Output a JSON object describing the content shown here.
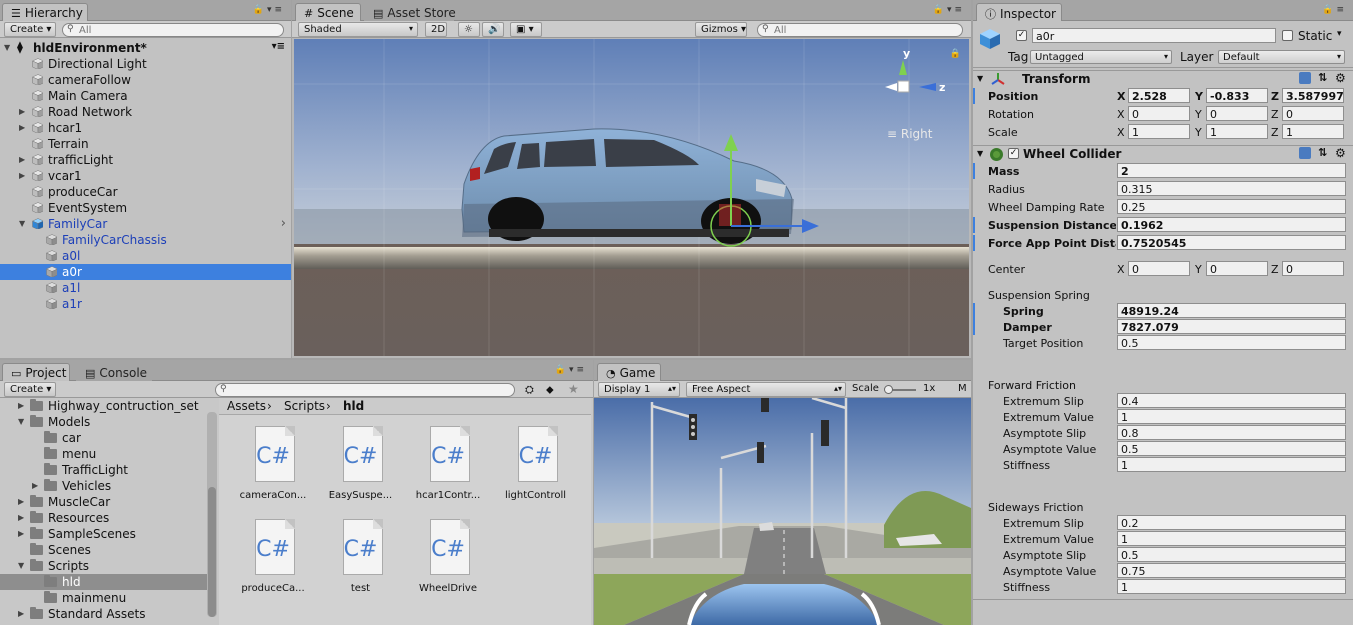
{
  "hierarchy": {
    "tab": "Hierarchy",
    "create_label": "Create",
    "search_placeholder": "All",
    "scene_name": "hldEnvironment*",
    "items": [
      {
        "label": "Directional Light",
        "expandable": false,
        "prefab": false
      },
      {
        "label": "cameraFollow",
        "expandable": false,
        "prefab": false
      },
      {
        "label": "Main Camera",
        "expandable": false,
        "prefab": false
      },
      {
        "label": "Road Network",
        "expandable": true,
        "prefab": false
      },
      {
        "label": "hcar1",
        "expandable": true,
        "prefab": false
      },
      {
        "label": "Terrain",
        "expandable": false,
        "prefab": false
      },
      {
        "label": "trafficLight",
        "expandable": true,
        "prefab": false
      },
      {
        "label": "vcar1",
        "expandable": true,
        "prefab": false
      },
      {
        "label": "produceCar",
        "expandable": false,
        "prefab": false
      },
      {
        "label": "EventSystem",
        "expandable": false,
        "prefab": false
      },
      {
        "label": "FamilyCar",
        "expandable": true,
        "expanded": true,
        "prefab": true
      },
      {
        "label": "FamilyCarChassis",
        "child": true,
        "prefab": true
      },
      {
        "label": "a0l",
        "child": true,
        "prefab": true
      },
      {
        "label": "a0r",
        "child": true,
        "prefab": true,
        "selected": true
      },
      {
        "label": "a1l",
        "child": true,
        "prefab": true
      },
      {
        "label": "a1r",
        "child": true,
        "prefab": true
      }
    ]
  },
  "scene": {
    "tabs": [
      "Scene",
      "Asset Store"
    ],
    "shading_mode": "Shaded",
    "mode_2d": "2D",
    "gizmos_label": "Gizmos",
    "search_placeholder": "All",
    "view_label": "Right",
    "axis_y": "y",
    "axis_z": "z"
  },
  "project": {
    "tabs": [
      "Project",
      "Console"
    ],
    "create_label": "Create",
    "folders": [
      {
        "label": "Highway_contruction_set",
        "level": 1,
        "expandable": true
      },
      {
        "label": "Models",
        "level": 1,
        "expandable": true,
        "expanded": true
      },
      {
        "label": "car",
        "level": 2,
        "expandable": false
      },
      {
        "label": "menu",
        "level": 2,
        "expandable": false
      },
      {
        "label": "TrafficLight",
        "level": 2,
        "expandable": false
      },
      {
        "label": "Vehicles",
        "level": 2,
        "expandable": true
      },
      {
        "label": "MuscleCar",
        "level": 1,
        "expandable": true
      },
      {
        "label": "Resources",
        "level": 1,
        "expandable": true
      },
      {
        "label": "SampleScenes",
        "level": 1,
        "expandable": true
      },
      {
        "label": "Scenes",
        "level": 1,
        "expandable": false
      },
      {
        "label": "Scripts",
        "level": 1,
        "expandable": true,
        "expanded": true
      },
      {
        "label": "hld",
        "level": 2,
        "expandable": false,
        "selected": true
      },
      {
        "label": "mainmenu",
        "level": 2,
        "expandable": false
      },
      {
        "label": "Standard Assets",
        "level": 1,
        "expandable": true
      }
    ],
    "breadcrumb": [
      "Assets",
      "Scripts",
      "hld"
    ],
    "assets": [
      {
        "icon": "C#",
        "name": "cameraCon..."
      },
      {
        "icon": "C#",
        "name": "EasySuspe..."
      },
      {
        "icon": "C#",
        "name": "hcar1Contr..."
      },
      {
        "icon": "C#",
        "name": "lightControll"
      },
      {
        "icon": "C#",
        "name": "produceCa..."
      },
      {
        "icon": "C#",
        "name": "test"
      },
      {
        "icon": "C#",
        "name": "WheelDrive"
      }
    ]
  },
  "game": {
    "tab": "Game",
    "display": "Display 1",
    "aspect": "Free Aspect",
    "scale_label": "Scale",
    "scale_value": "1x",
    "maximize_label": "M"
  },
  "inspector": {
    "tab": "Inspector",
    "object_name": "a0r",
    "static_label": "Static",
    "tag_label": "Tag",
    "tag_value": "Untagged",
    "layer_label": "Layer",
    "layer_value": "Default",
    "transform": {
      "title": "Transform",
      "position_label": "Position",
      "rotation_label": "Rotation",
      "scale_label": "Scale",
      "position": {
        "x": "2.528",
        "y": "-0.833",
        "z": "3.587997"
      },
      "rotation": {
        "x": "0",
        "y": "0",
        "z": "0"
      },
      "scale": {
        "x": "1",
        "y": "1",
        "z": "1"
      }
    },
    "axes": {
      "x": "X",
      "y": "Y",
      "z": "Z"
    },
    "wheel_collider": {
      "title": "Wheel Collider",
      "fields": [
        {
          "label": "Mass",
          "value": "2",
          "bold": true
        },
        {
          "label": "Radius",
          "value": "0.315",
          "bold": false
        },
        {
          "label": "Wheel Damping Rate",
          "value": "0.25",
          "bold": false
        },
        {
          "label": "Suspension Distance",
          "value": "0.1962",
          "bold": true
        },
        {
          "label": "Force App Point Distance",
          "value": "0.7520545",
          "bold": true
        }
      ],
      "center_label": "Center",
      "center": {
        "x": "0",
        "y": "0",
        "z": "0"
      },
      "suspension_spring": {
        "title": "Suspension Spring",
        "fields": [
          {
            "label": "Spring",
            "value": "48919.24",
            "bold": true
          },
          {
            "label": "Damper",
            "value": "7827.079",
            "bold": true
          },
          {
            "label": "Target Position",
            "value": "0.5",
            "bold": false
          }
        ]
      },
      "forward_friction": {
        "title": "Forward Friction",
        "fields": [
          {
            "label": "Extremum Slip",
            "value": "0.4"
          },
          {
            "label": "Extremum Value",
            "value": "1"
          },
          {
            "label": "Asymptote Slip",
            "value": "0.8"
          },
          {
            "label": "Asymptote Value",
            "value": "0.5"
          },
          {
            "label": "Stiffness",
            "value": "1"
          }
        ]
      },
      "sideways_friction": {
        "title": "Sideways Friction",
        "fields": [
          {
            "label": "Extremum Slip",
            "value": "0.2"
          },
          {
            "label": "Extremum Value",
            "value": "1"
          },
          {
            "label": "Asymptote Slip",
            "value": "0.5"
          },
          {
            "label": "Asymptote Value",
            "value": "0.75"
          },
          {
            "label": "Stiffness",
            "value": "1"
          }
        ]
      }
    }
  }
}
